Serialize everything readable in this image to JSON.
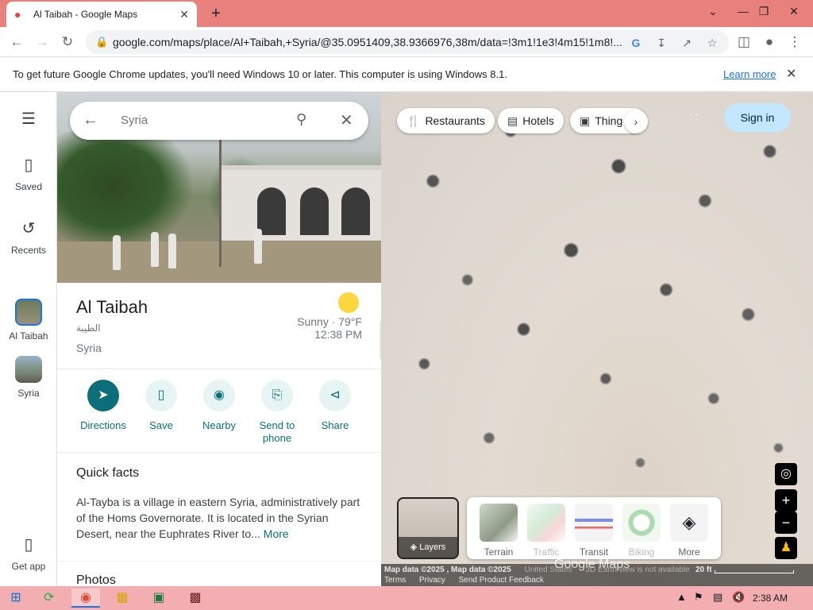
{
  "browser": {
    "tab_title": "Al Taibah - Google Maps",
    "url": "google.com/maps/place/Al+Taibah,+Syria/@35.0951409,38.9366976,38m/data=!3m1!1e3!4m15!1m8!..."
  },
  "infobar": {
    "message": "To get future Google Chrome updates, you'll need Windows 10 or later. This computer is using Windows 8.1.",
    "learn_more": "Learn more"
  },
  "rail": {
    "saved": "Saved",
    "recents": "Recents",
    "al_taibah": "Al Taibah",
    "syria": "Syria",
    "get_app": "Get app"
  },
  "search": {
    "query": "Syria"
  },
  "place": {
    "name": "Al Taibah",
    "arabic_name": "الطيبة",
    "country": "Syria",
    "weather": "Sunny · 79°F",
    "time": "12:38 PM"
  },
  "actions": {
    "directions": "Directions",
    "save": "Save",
    "nearby": "Nearby",
    "send_to_phone": "Send to phone",
    "share": "Share"
  },
  "quick_facts": {
    "title": "Quick facts",
    "text": "Al-Tayba is a village in eastern Syria, administratively part of the Homs Governorate. It is located in the Syrian Desert, near the Euphrates River to...",
    "more": "More"
  },
  "photos": {
    "title": "Photos"
  },
  "map": {
    "chips": {
      "restaurants": "Restaurants",
      "hotels": "Hotels",
      "things": "Thing"
    },
    "sign_in": "Sign in",
    "layers_label": "Layers",
    "layer_options": {
      "terrain": "Terrain",
      "traffic": "Traffic",
      "transit": "Transit",
      "biking": "Biking",
      "more": "More"
    },
    "watermark": "Google Maps",
    "footer": {
      "map_data": "Map data ©2025 , Map data ©2025",
      "country": "United States",
      "earth_note": "3D Earth view is not available",
      "scale": "20 ft",
      "terms": "Terms",
      "privacy": "Privacy",
      "feedback": "Send Product Feedback"
    }
  },
  "taskbar": {
    "time": "2:38 AM"
  },
  "colors": {
    "accent": "#0b6e78",
    "titlebar": "#e8807c",
    "taskbar": "#f2aeb0",
    "link": "#1a73e8"
  }
}
